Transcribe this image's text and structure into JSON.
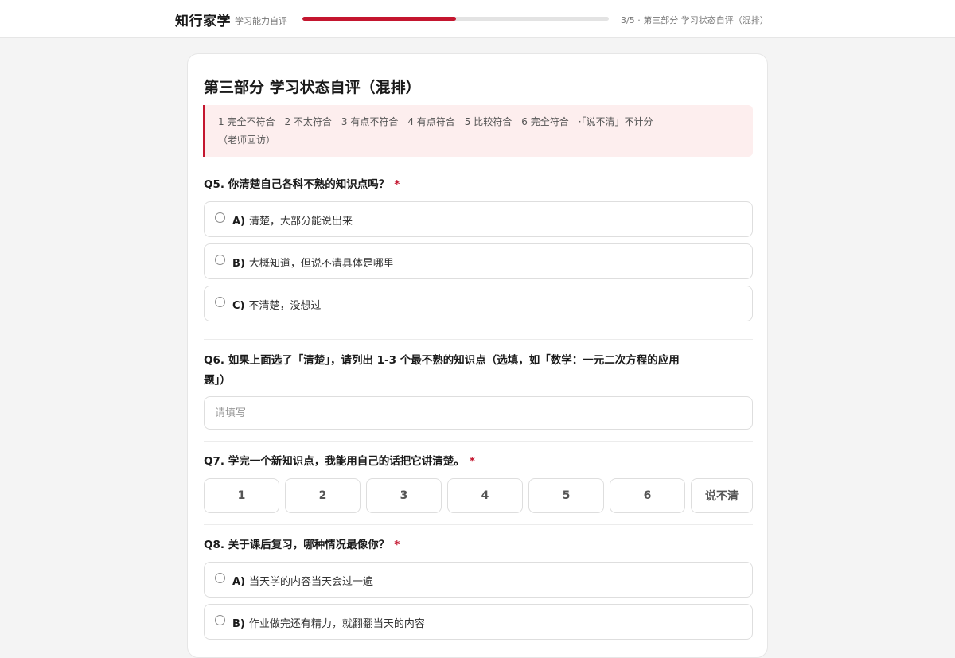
{
  "header": {
    "brand": "知行家学",
    "subtitle": "学习能力自评",
    "progress_fraction": 0.5,
    "progress_text": "3/5 · 第三部分 学习状态自评（混排）"
  },
  "section": {
    "title": "第三部分 学习状态自评（混排）",
    "scale_note_line1": "1 完全不符合　2 不太符合　3 有点不符合　4 有点符合　5 比较符合　6 完全符合　·「说不清」不计分",
    "scale_note_line2": "（老师回访）"
  },
  "questions": {
    "q5": {
      "title": "Q5. 你清楚自己各科不熟的知识点吗？",
      "required_mark": "*",
      "options": [
        {
          "letter": "A)",
          "text": "清楚，大部分能说出来"
        },
        {
          "letter": "B)",
          "text": "大概知道，但说不清具体是哪里"
        },
        {
          "letter": "C)",
          "text": "不清楚，没想过"
        }
      ]
    },
    "q6": {
      "title_line1": "Q6. 如果上面选了「清楚」，请列出 1-3 个最不熟的知识点（选填，如「数学：一元二次方程的应用",
      "title_line2": "题」）",
      "placeholder": "请填写"
    },
    "q7": {
      "title": "Q7. 学完一个新知识点，我能用自己的话把它讲清楚。",
      "required_mark": "*",
      "scale": [
        "1",
        "2",
        "3",
        "4",
        "5",
        "6",
        "说不清"
      ]
    },
    "q8": {
      "title": "Q8. 关于课后复习，哪种情况最像你？",
      "required_mark": "*",
      "options": [
        {
          "letter": "A)",
          "text": "当天学的内容当天会过一遍"
        },
        {
          "letter": "B)",
          "text": "作业做完还有精力，就翻翻当天的内容"
        }
      ]
    }
  }
}
